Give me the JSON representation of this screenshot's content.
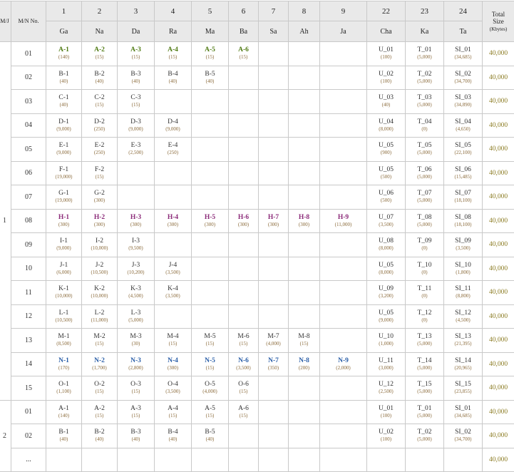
{
  "headers": {
    "mj": "M/J",
    "mn": "M/N No.",
    "total": {
      "line1": "Total",
      "line2": "Size",
      "unit": "(Kbytes)"
    },
    "columns": [
      {
        "num": "1",
        "name": "Ga"
      },
      {
        "num": "2",
        "name": "Na"
      },
      {
        "num": "3",
        "name": "Da"
      },
      {
        "num": "4",
        "name": "Ra"
      },
      {
        "num": "5",
        "name": "Ma"
      },
      {
        "num": "6",
        "name": "Ba"
      },
      {
        "num": "7",
        "name": "Sa"
      },
      {
        "num": "8",
        "name": "Ah"
      },
      {
        "num": "9",
        "name": "Ja"
      },
      {
        "num": "22",
        "name": "Cha"
      },
      {
        "num": "23",
        "name": "Ka"
      },
      {
        "num": "24",
        "name": "Ta"
      }
    ]
  },
  "groups": [
    {
      "label": "1",
      "rows": [
        {
          "no": "01",
          "hl": "green",
          "total": "40,000",
          "cells": [
            {
              "v": "A-1",
              "s": "(140)"
            },
            {
              "v": "A-2",
              "s": "(15)"
            },
            {
              "v": "A-3",
              "s": "(15)"
            },
            {
              "v": "A-4",
              "s": "(15)"
            },
            {
              "v": "A-5",
              "s": "(15)"
            },
            {
              "v": "A-6",
              "s": "(15)"
            },
            {},
            {},
            {},
            {
              "v": "U_01",
              "s": "(100)"
            },
            {
              "v": "T_01",
              "s": "(5,000)"
            },
            {
              "v": "SI_01",
              "s": "(34,685)"
            }
          ]
        },
        {
          "no": "02",
          "hl": "",
          "total": "40,000",
          "cells": [
            {
              "v": "B-1",
              "s": "(40)"
            },
            {
              "v": "B-2",
              "s": "(40)"
            },
            {
              "v": "B-3",
              "s": "(40)"
            },
            {
              "v": "B-4",
              "s": "(40)"
            },
            {
              "v": "B-5",
              "s": "(40)"
            },
            {},
            {},
            {},
            {},
            {
              "v": "U_02",
              "s": "(100)"
            },
            {
              "v": "T_02",
              "s": "(5,000)"
            },
            {
              "v": "SI_02",
              "s": "(34,700)"
            }
          ]
        },
        {
          "no": "03",
          "hl": "",
          "total": "40,000",
          "cells": [
            {
              "v": "C-1",
              "s": "(40)"
            },
            {
              "v": "C-2",
              "s": "(15)"
            },
            {
              "v": "C-3",
              "s": "(15)"
            },
            {},
            {},
            {},
            {},
            {},
            {},
            {
              "v": "U_03",
              "s": "(40)"
            },
            {
              "v": "T_03",
              "s": "(5,000)"
            },
            {
              "v": "SI_03",
              "s": "(34,890)"
            }
          ]
        },
        {
          "no": "04",
          "hl": "",
          "total": "40,000",
          "cells": [
            {
              "v": "D-1",
              "s": "(9,000)"
            },
            {
              "v": "D-2",
              "s": "(250)"
            },
            {
              "v": "D-3",
              "s": "(9,000)"
            },
            {
              "v": "D-4",
              "s": "(9,000)"
            },
            {},
            {},
            {},
            {},
            {},
            {
              "v": "U_04",
              "s": "(8,000)"
            },
            {
              "v": "T_04",
              "s": "(0)"
            },
            {
              "v": "SI_04",
              "s": "(4,650)"
            }
          ]
        },
        {
          "no": "05",
          "hl": "",
          "total": "40,000",
          "cells": [
            {
              "v": "E-1",
              "s": "(9,000)"
            },
            {
              "v": "E-2",
              "s": "(250)"
            },
            {
              "v": "E-3",
              "s": "(2,500)"
            },
            {
              "v": "E-4",
              "s": "(250)"
            },
            {},
            {},
            {},
            {},
            {},
            {
              "v": "U_05",
              "s": "(900)"
            },
            {
              "v": "T_05",
              "s": "(5,000)"
            },
            {
              "v": "SI_05",
              "s": "(22,100)"
            }
          ]
        },
        {
          "no": "06",
          "hl": "",
          "total": "40,000",
          "cells": [
            {
              "v": "F-1",
              "s": "(19,000)"
            },
            {
              "v": "F-2",
              "s": "(15)"
            },
            {},
            {},
            {},
            {},
            {},
            {},
            {},
            {
              "v": "U_05",
              "s": "(500)"
            },
            {
              "v": "T_06",
              "s": "(5,000)"
            },
            {
              "v": "SI_06",
              "s": "(15,485)"
            }
          ]
        },
        {
          "no": "07",
          "hl": "",
          "total": "40,000",
          "cells": [
            {
              "v": "G-1",
              "s": "(19,000)"
            },
            {
              "v": "G-2",
              "s": "(300)"
            },
            {},
            {},
            {},
            {},
            {},
            {},
            {},
            {
              "v": "U_06",
              "s": "(500)"
            },
            {
              "v": "T_07",
              "s": "(5,000)"
            },
            {
              "v": "SI_07",
              "s": "(18,100)"
            }
          ]
        },
        {
          "no": "08",
          "hl": "purple",
          "total": "40,000",
          "cells": [
            {
              "v": "H-1",
              "s": "(300)"
            },
            {
              "v": "H-2",
              "s": "(300)"
            },
            {
              "v": "H-3",
              "s": "(300)"
            },
            {
              "v": "H-4",
              "s": "(300)"
            },
            {
              "v": "H-5",
              "s": "(300)"
            },
            {
              "v": "H-6",
              "s": "(300)"
            },
            {
              "v": "H-7",
              "s": "(300)"
            },
            {
              "v": "H-8",
              "s": "(300)"
            },
            {
              "v": "H-9",
              "s": "(11,000)"
            },
            {
              "v": "U_07",
              "s": "(3,500)"
            },
            {
              "v": "T_08",
              "s": "(5,000)"
            },
            {
              "v": "SI_08",
              "s": "(18,100)"
            }
          ]
        },
        {
          "no": "09",
          "hl": "",
          "total": "40,000",
          "cells": [
            {
              "v": "I-1",
              "s": "(9,000)"
            },
            {
              "v": "I-2",
              "s": "(10,000)"
            },
            {
              "v": "I-3",
              "s": "(9,500)"
            },
            {},
            {},
            {},
            {},
            {},
            {},
            {
              "v": "U_08",
              "s": "(8,000)"
            },
            {
              "v": "T_09",
              "s": "(0)"
            },
            {
              "v": "SI_09",
              "s": "(3,500)"
            }
          ]
        },
        {
          "no": "10",
          "hl": "",
          "total": "40,000",
          "cells": [
            {
              "v": "J-1",
              "s": "(6,000)"
            },
            {
              "v": "J-2",
              "s": "(10,500)"
            },
            {
              "v": "J-3",
              "s": "(10,200)"
            },
            {
              "v": "J-4",
              "s": "(3,500)"
            },
            {},
            {},
            {},
            {},
            {},
            {
              "v": "U_05",
              "s": "(8,000)"
            },
            {
              "v": "T_10",
              "s": "(0)"
            },
            {
              "v": "SI_10",
              "s": "(1,800)"
            }
          ]
        },
        {
          "no": "11",
          "hl": "",
          "total": "40,000",
          "cells": [
            {
              "v": "K-1",
              "s": "(10,000)"
            },
            {
              "v": "K-2",
              "s": "(10,000)"
            },
            {
              "v": "K-3",
              "s": "(4,500)"
            },
            {
              "v": "K-4",
              "s": "(3,500)"
            },
            {},
            {},
            {},
            {},
            {},
            {
              "v": "U_09",
              "s": "(3,200)"
            },
            {
              "v": "T_11",
              "s": "(0)"
            },
            {
              "v": "SI_11",
              "s": "(8,800)"
            }
          ]
        },
        {
          "no": "12",
          "hl": "",
          "total": "40,000",
          "cells": [
            {
              "v": "L-1",
              "s": "(10,500)"
            },
            {
              "v": "L-2",
              "s": "(11,000)"
            },
            {
              "v": "L-3",
              "s": "(5,000)"
            },
            {},
            {},
            {},
            {},
            {},
            {},
            {
              "v": "U_05",
              "s": "(9,000)"
            },
            {
              "v": "T_12",
              "s": "(0)"
            },
            {
              "v": "SI_12",
              "s": "(4,500)"
            }
          ]
        },
        {
          "no": "13",
          "hl": "",
          "total": "40,000",
          "cells": [
            {
              "v": "M-1",
              "s": "(8,500)"
            },
            {
              "v": "M-2",
              "s": "(15)"
            },
            {
              "v": "M-3",
              "s": "(30)"
            },
            {
              "v": "M-4",
              "s": "(15)"
            },
            {
              "v": "M-5",
              "s": "(15)"
            },
            {
              "v": "M-6",
              "s": "(15)"
            },
            {
              "v": "M-7",
              "s": "(4,000)"
            },
            {
              "v": "M-8",
              "s": "(15)"
            },
            {},
            {
              "v": "U_10",
              "s": "(1,000)"
            },
            {
              "v": "T_13",
              "s": "(5,000)"
            },
            {
              "v": "SI_13",
              "s": "(21,395)"
            }
          ]
        },
        {
          "no": "14",
          "hl": "blue",
          "total": "40,000",
          "cells": [
            {
              "v": "N-1",
              "s": "(170)"
            },
            {
              "v": "N-2",
              "s": "(1,700)"
            },
            {
              "v": "N-3",
              "s": "(2,800)"
            },
            {
              "v": "N-4",
              "s": "(300)"
            },
            {
              "v": "N-5",
              "s": "(15)"
            },
            {
              "v": "N-6",
              "s": "(3,500)"
            },
            {
              "v": "N-7",
              "s": "(350)"
            },
            {
              "v": "N-8",
              "s": "(200)"
            },
            {
              "v": "N-9",
              "s": "(2,000)"
            },
            {
              "v": "U_11",
              "s": "(3,000)"
            },
            {
              "v": "T_14",
              "s": "(5,000)"
            },
            {
              "v": "SI_14",
              "s": "(20,965)"
            }
          ]
        },
        {
          "no": "15",
          "hl": "",
          "total": "40,000",
          "cells": [
            {
              "v": "O-1",
              "s": "(1,100)"
            },
            {
              "v": "O-2",
              "s": "(15)"
            },
            {
              "v": "O-3",
              "s": "(15)"
            },
            {
              "v": "O-4",
              "s": "(3,500)"
            },
            {
              "v": "O-5",
              "s": "(4,000)"
            },
            {
              "v": "O-6",
              "s": "(15)"
            },
            {},
            {},
            {},
            {
              "v": "U_12",
              "s": "(2,500)"
            },
            {
              "v": "T_15",
              "s": "(5,000)"
            },
            {
              "v": "SI_15",
              "s": "(23,855)"
            }
          ]
        }
      ]
    },
    {
      "label": "2",
      "rows": [
        {
          "no": "01",
          "hl": "",
          "total": "40,000",
          "cells": [
            {
              "v": "A-1",
              "s": "(140)"
            },
            {
              "v": "A-2",
              "s": "(15)"
            },
            {
              "v": "A-3",
              "s": "(15)"
            },
            {
              "v": "A-4",
              "s": "(15)"
            },
            {
              "v": "A-5",
              "s": "(15)"
            },
            {
              "v": "A-6",
              "s": "(15)"
            },
            {},
            {},
            {},
            {
              "v": "U_01",
              "s": "(100)"
            },
            {
              "v": "T_01",
              "s": "(5,000)"
            },
            {
              "v": "SI_01",
              "s": "(34,685)"
            }
          ]
        },
        {
          "no": "02",
          "hl": "",
          "total": "40,000",
          "cells": [
            {
              "v": "B-1",
              "s": "(40)"
            },
            {
              "v": "B-2",
              "s": "(40)"
            },
            {
              "v": "B-3",
              "s": "(40)"
            },
            {
              "v": "B-4",
              "s": "(40)"
            },
            {
              "v": "B-5",
              "s": "(40)"
            },
            {},
            {},
            {},
            {},
            {
              "v": "U_02",
              "s": "(100)"
            },
            {
              "v": "T_02",
              "s": "(5,000)"
            },
            {
              "v": "SI_02",
              "s": "(34,700)"
            }
          ]
        },
        {
          "no": "...",
          "hl": "",
          "total": "40,000",
          "cells": [
            {},
            {},
            {},
            {},
            {},
            {},
            {},
            {},
            {},
            {},
            {},
            {}
          ]
        }
      ]
    }
  ]
}
